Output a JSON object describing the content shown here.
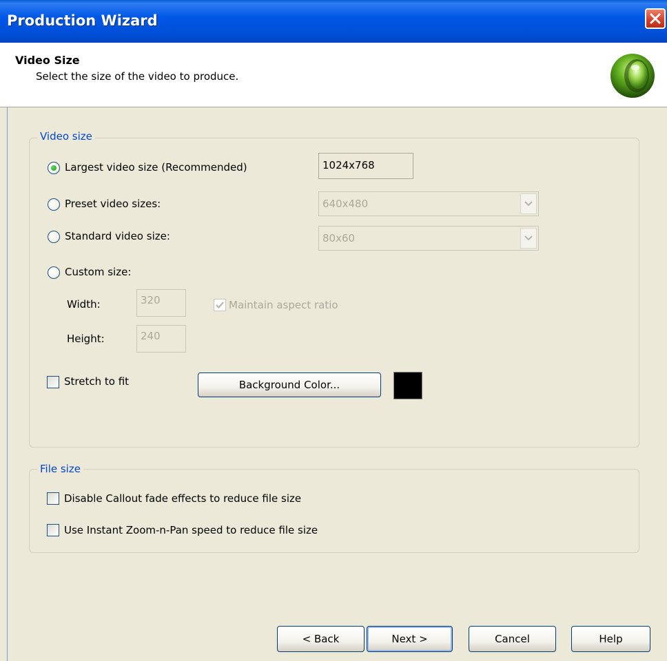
{
  "window": {
    "title": "Production Wizard"
  },
  "header": {
    "title": "Video Size",
    "subtitle": "Select the size of the video to produce."
  },
  "video_size_group": {
    "label": "Video size",
    "options": {
      "largest": {
        "label": "Largest video size (Recommended)",
        "value": "1024x768",
        "selected": true
      },
      "preset": {
        "label": "Preset video sizes:",
        "value": "640x480",
        "selected": false
      },
      "standard": {
        "label": "Standard video size:",
        "value": "80x60",
        "selected": false
      },
      "custom": {
        "label": "Custom size:",
        "selected": false
      }
    },
    "width": {
      "label": "Width:",
      "value": "320"
    },
    "height": {
      "label": "Height:",
      "value": "240"
    },
    "maintain_aspect": {
      "label": "Maintain aspect ratio",
      "checked": true,
      "enabled": false
    },
    "stretch": {
      "label": "Stretch to fit",
      "checked": false
    },
    "background_button": {
      "label": "Background Color..."
    },
    "background_color": "#000000"
  },
  "file_size_group": {
    "label": "File size",
    "disable_callout": {
      "label": "Disable Callout fade effects to reduce file size",
      "checked": false
    },
    "instant_zoom": {
      "label": "Use Instant Zoom-n-Pan speed to reduce file size",
      "checked": false
    }
  },
  "footer": {
    "back": "< Back",
    "next": "Next >",
    "cancel": "Cancel",
    "help": "Help"
  },
  "colors": {
    "titlebar": "#0058E6",
    "group_label": "#0046D5",
    "dialog_bg": "#ECE9D8"
  }
}
